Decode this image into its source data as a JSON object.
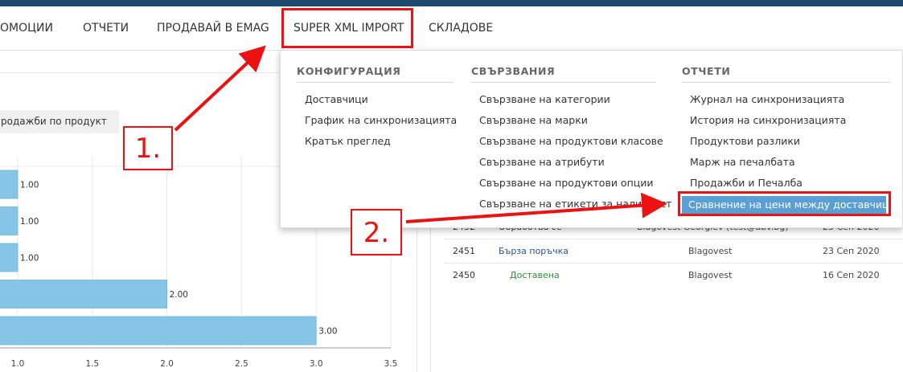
{
  "nav": {
    "items": [
      "ОМОЦИИ",
      "ОТЧЕТИ",
      "ПРОДАВАЙ В EMAG",
      "SUPER XML IMPORT",
      "СКЛАДОВЕ"
    ]
  },
  "left": {
    "sales_button": "Продажби по продукт"
  },
  "chart_data": {
    "type": "bar",
    "orientation": "horizontal",
    "values": [
      1.0,
      1.0,
      1.0,
      2.0,
      3.0
    ],
    "value_labels": [
      "1.00",
      "1.00",
      "1.00",
      "2.00",
      "3.00"
    ],
    "x_ticks": [
      "1.0",
      "1.5",
      "2.0",
      "2.5",
      "3.0",
      "3.5"
    ],
    "xlim": [
      1.0,
      3.5
    ],
    "bar_color": "#86c5e6",
    "grid": true
  },
  "dropdown": {
    "columns": [
      {
        "title": "КОНФИГУРАЦИЯ",
        "links": [
          "Доставчици",
          "График на синхронизацията",
          "Кратък преглед"
        ]
      },
      {
        "title": "СВЪРЗВАНИЯ",
        "links": [
          "Свързване на категории",
          "Свързване на марки",
          "Свързване на продуктови класове",
          "Свързване на атрибути",
          "Свързване на продуктови опции",
          "Свързване на етикети за наличност"
        ]
      },
      {
        "title": "ОТЧЕТИ",
        "links": [
          "Журнал на синхронизацията",
          "История на синхронизацията",
          "Продуктови разлики",
          "Марж на печалбата",
          "Продажби и Печалба",
          "Сравнение на цени между доставчици"
        ]
      }
    ]
  },
  "orders": [
    {
      "id": "2452",
      "status": "Обработва се",
      "status_color": "#333333",
      "customer": "Blagovest Georgiev (test@abv.bg)",
      "date": "23 Сеп 2020"
    },
    {
      "id": "2451",
      "status": "Бърза поръчка",
      "status_color": "#2a4f8f",
      "customer": "Blagovest",
      "date": "23 Сеп 2020"
    },
    {
      "id": "2450",
      "status": "Доставена",
      "status_color": "#2e8b3a",
      "customer": "Blagovest",
      "date": "16 Сеп 2020"
    }
  ],
  "annotations": {
    "step1": "1.",
    "step2": "2.",
    "color": "#ee1111"
  }
}
